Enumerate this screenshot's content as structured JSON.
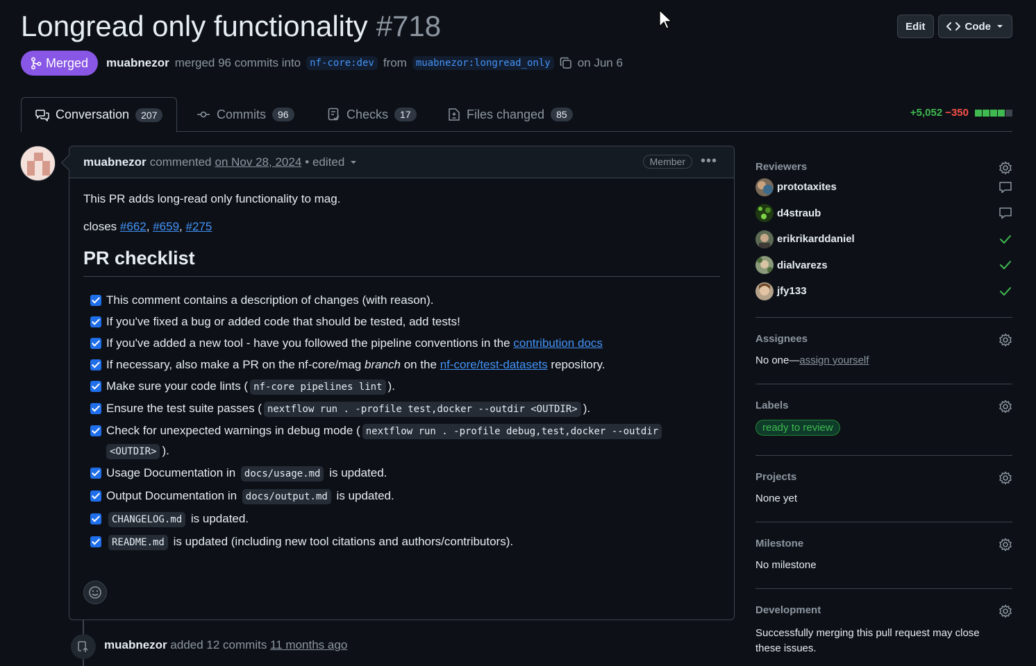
{
  "pr": {
    "title": "Longread only functionality",
    "number": "#718",
    "state": "Merged",
    "author": "muabnezor",
    "merge_text": "merged 96 commits into",
    "base_branch": "nf-core:dev",
    "from_text": "from",
    "head_branch": "muabnezor:longread_only",
    "merged_date": "on Jun 6"
  },
  "header_buttons": {
    "edit": "Edit",
    "code": "Code"
  },
  "tabs": [
    {
      "label": "Conversation",
      "count": "207"
    },
    {
      "label": "Commits",
      "count": "96"
    },
    {
      "label": "Checks",
      "count": "17"
    },
    {
      "label": "Files changed",
      "count": "85"
    }
  ],
  "diffstat": {
    "additions": "+5,052",
    "deletions": "−350",
    "colors": [
      "#3fb950",
      "#3fb950",
      "#3fb950",
      "#3fb950",
      "#3d444d"
    ]
  },
  "comment": {
    "author": "muabnezor",
    "action": "commented",
    "date": "on Nov 28, 2024",
    "edited": "• edited",
    "role": "Member",
    "intro": "This PR adds long-read only functionality to mag.",
    "closes_label": "closes",
    "closes": [
      "#662",
      "#659",
      "#275"
    ],
    "heading": "PR checklist",
    "checklist": {
      "i1": "This comment contains a description of changes (with reason).",
      "i2": "If you've fixed a bug or added code that should be tested, add tests!",
      "i3_pre": "If you've added a new tool - have you followed the pipeline conventions in the",
      "i3_link": "contribution docs",
      "i4_pre": "If necessary, also make a PR on the nf-core/mag",
      "i4_em": "branch",
      "i4_mid": "on the",
      "i4_link": "nf-core/test-datasets",
      "i4_post": "repository.",
      "i5_pre": "Make sure your code lints (",
      "i5_code": "nf-core pipelines lint",
      "i5_post": ").",
      "i6_pre": "Ensure the test suite passes (",
      "i6_code": "nextflow run . -profile test,docker --outdir <OUTDIR>",
      "i6_post": ").",
      "i7_pre": "Check for unexpected warnings in debug mode (",
      "i7_code": "nextflow run . -profile debug,test,docker --outdir",
      "i7_code2": "<OUTDIR>",
      "i7_post": ").",
      "i8_pre": "Usage Documentation in",
      "i8_code": "docs/usage.md",
      "i8_post": "is updated.",
      "i9_pre": "Output Documentation in",
      "i9_code": "docs/output.md",
      "i9_post": "is updated.",
      "i10_code": "CHANGELOG.md",
      "i10_post": "is updated.",
      "i11_code": "README.md",
      "i11_post": "is updated (including new tool citations and authors/contributors)."
    }
  },
  "timeline": {
    "author": "muabnezor",
    "action": "added 12 commits",
    "time": "11 months ago"
  },
  "sidebar": {
    "reviewers_title": "Reviewers",
    "reviewers": [
      {
        "name": "prototaxites",
        "status": "commented"
      },
      {
        "name": "d4straub",
        "status": "commented"
      },
      {
        "name": "erikrikarddaniel",
        "status": "approved"
      },
      {
        "name": "dialvarezs",
        "status": "approved"
      },
      {
        "name": "jfy133",
        "status": "approved"
      }
    ],
    "assignees_title": "Assignees",
    "assignees_none": "No one—",
    "assign_yourself": "assign yourself",
    "labels_title": "Labels",
    "label": "ready to review",
    "projects_title": "Projects",
    "projects_value": "None yet",
    "milestone_title": "Milestone",
    "milestone_value": "No milestone",
    "development_title": "Development",
    "development_value": "Successfully merging this pull request may close these issues."
  }
}
